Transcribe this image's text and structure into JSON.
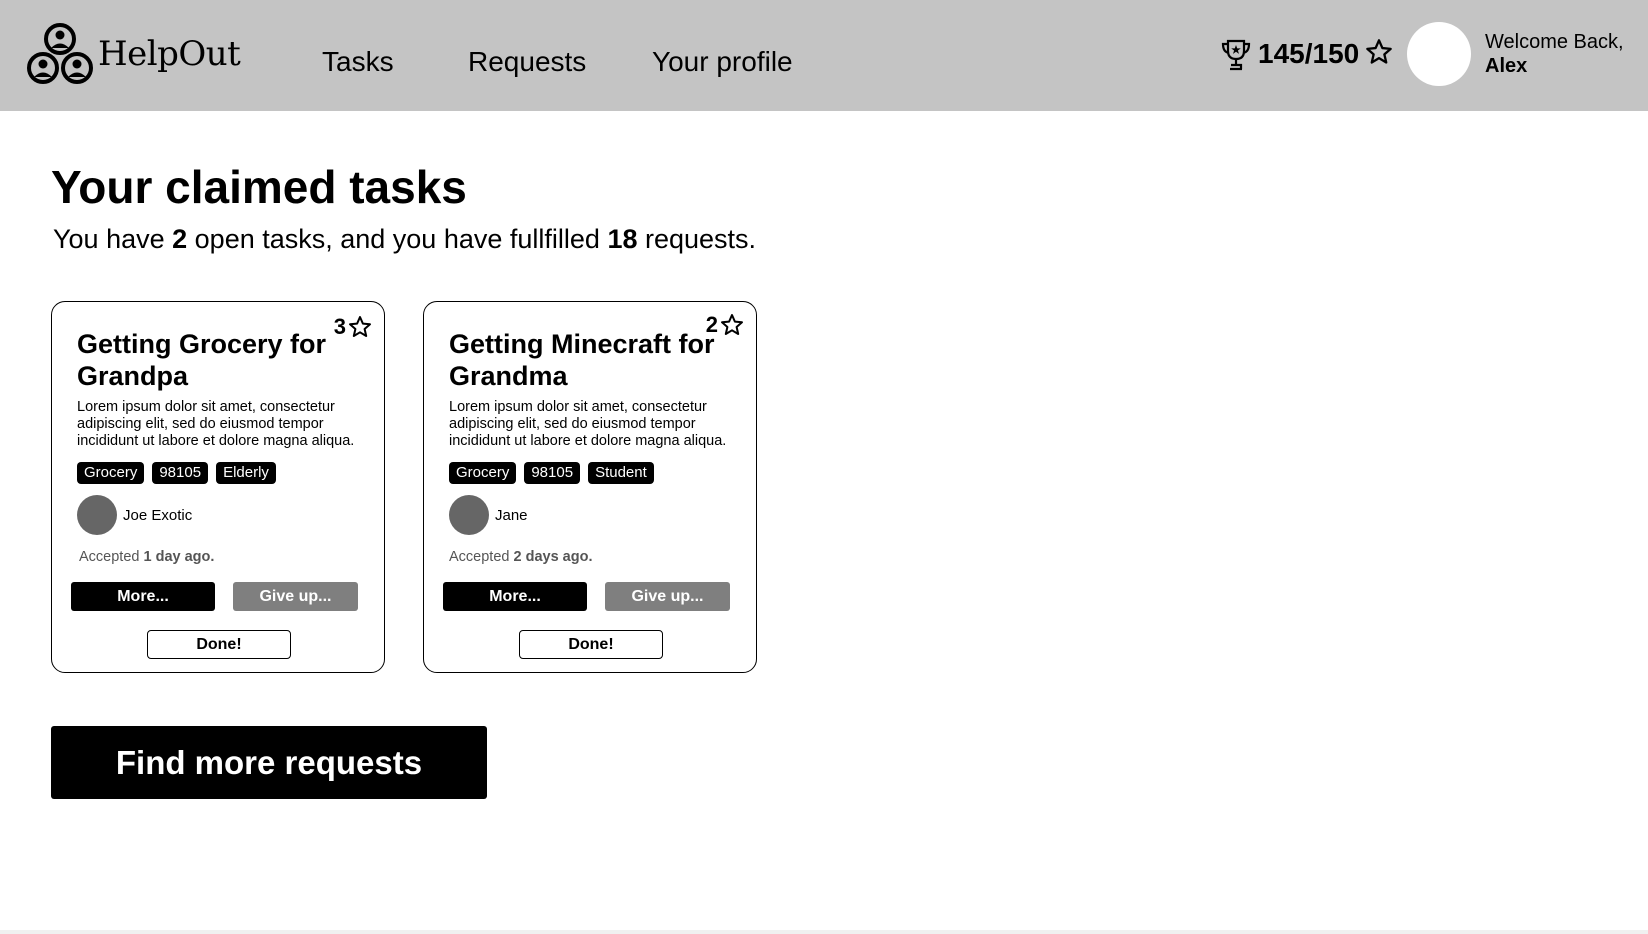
{
  "app": {
    "name": "HelpOut"
  },
  "nav": {
    "tasks": "Tasks",
    "requests": "Requests",
    "profile": "Your profile"
  },
  "user": {
    "score": "145/150",
    "welcome": "Welcome Back,",
    "name": "Alex"
  },
  "main": {
    "title": "Your claimed tasks",
    "summary_pre": "You have ",
    "open_count": "2",
    "summary_mid": " open tasks, and you have fullfilled ",
    "fulfilled_count": "18",
    "summary_post": " requests.",
    "find_button": "Find more requests"
  },
  "tasks": [
    {
      "title": "Getting Grocery for Grandpa",
      "rating": "3",
      "description": "Lorem ipsum dolor sit amet, consectetur adipiscing elit, sed do eiusmod tempor incididunt ut labore et dolore magna aliqua.",
      "tags": [
        "Grocery",
        "98105",
        "Elderly"
      ],
      "requester": "Joe Exotic",
      "accepted_label": "Accepted ",
      "accepted_when": "1 day ago.",
      "more_label": "More...",
      "giveup_label": "Give up...",
      "done_label": "Done!"
    },
    {
      "title": "Getting Minecraft for Grandma",
      "rating": "2",
      "description": "Lorem ipsum dolor sit amet, consectetur adipiscing elit, sed do eiusmod tempor incididunt ut labore et dolore magna aliqua.",
      "tags": [
        "Grocery",
        "98105",
        "Student"
      ],
      "requester": "Jane",
      "accepted_label": "Accepted ",
      "accepted_when": "2 days ago.",
      "more_label": "More...",
      "giveup_label": "Give up...",
      "done_label": "Done!"
    }
  ],
  "icons": {
    "logo": "people-group-icon",
    "trophy": "trophy-icon",
    "star": "star-icon"
  },
  "colors": {
    "navbar": "#c4c4c4",
    "primary": "#000000",
    "secondary_button": "#7f7f7f",
    "avatar": "#666666"
  }
}
